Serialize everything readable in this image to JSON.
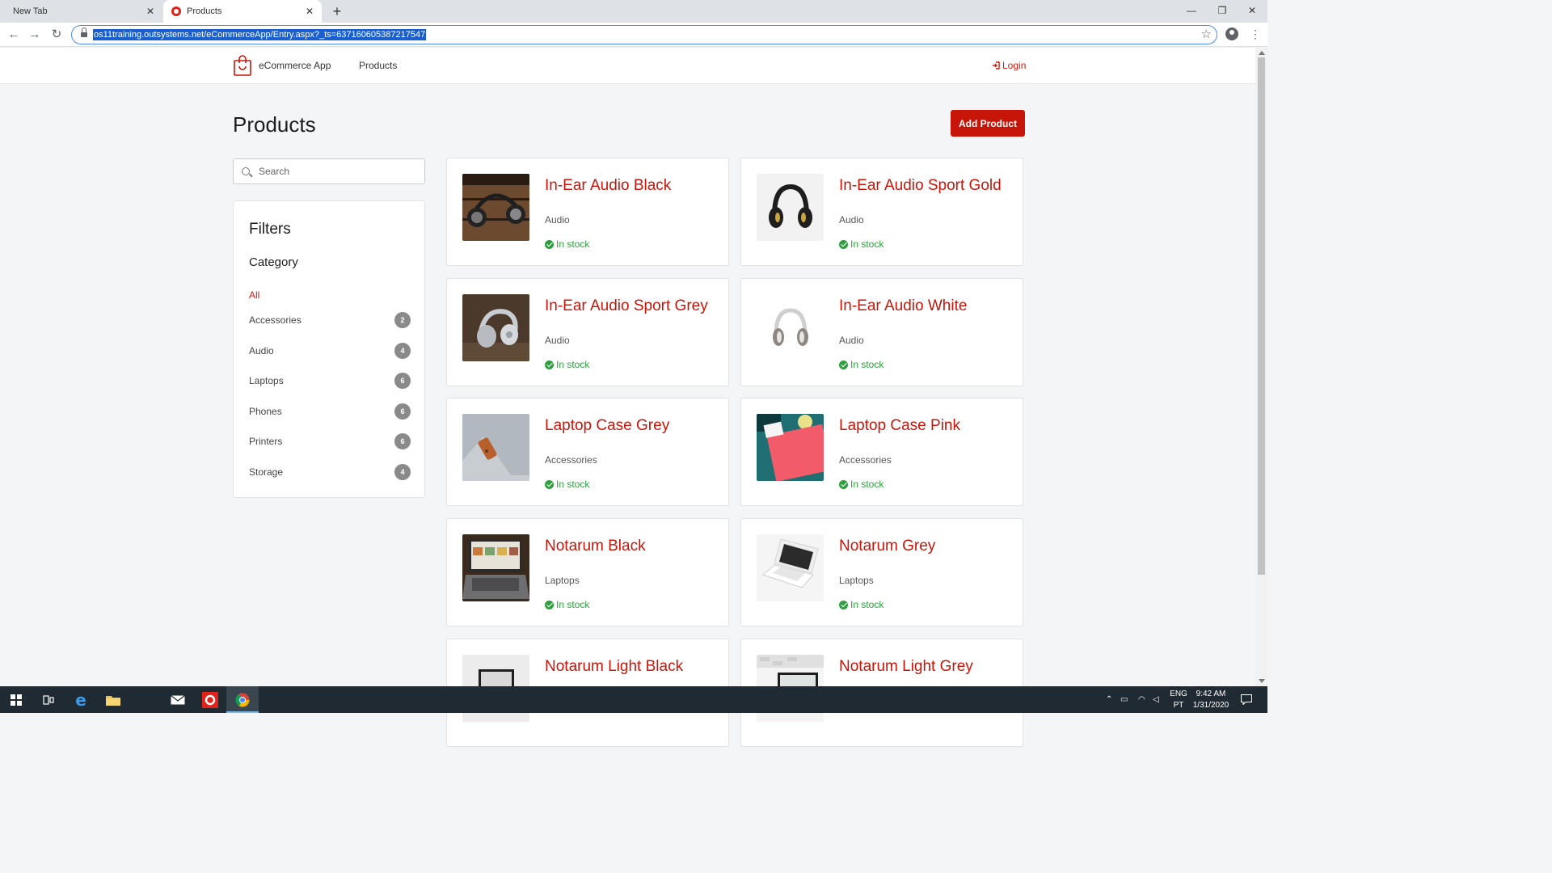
{
  "browser": {
    "tabs": [
      {
        "label": "New Tab",
        "active": false
      },
      {
        "label": "Products",
        "active": true
      }
    ],
    "url": "os11training.outsystems.net/eCommerceApp/Entry.aspx?_ts=637160605387217547"
  },
  "header": {
    "brand": "eCommerce App",
    "nav_products": "Products",
    "login": "Login"
  },
  "page": {
    "title": "Products",
    "add_button": "Add Product",
    "search_placeholder": "Search"
  },
  "filters": {
    "title": "Filters",
    "category_heading": "Category",
    "all_label": "All",
    "categories": [
      {
        "label": "Accessories",
        "count": "2"
      },
      {
        "label": "Audio",
        "count": "4"
      },
      {
        "label": "Laptops",
        "count": "6"
      },
      {
        "label": "Phones",
        "count": "6"
      },
      {
        "label": "Printers",
        "count": "6"
      },
      {
        "label": "Storage",
        "count": "4"
      }
    ]
  },
  "products": [
    {
      "name": "In-Ear Audio Black",
      "category": "Audio",
      "stock": "In stock",
      "thumb": "headphones-on-wood"
    },
    {
      "name": "In-Ear Audio Sport Gold",
      "category": "Audio",
      "stock": "In stock",
      "thumb": "headphones-black-gold"
    },
    {
      "name": "In-Ear Audio Sport Grey",
      "category": "Audio",
      "stock": "In stock",
      "thumb": "headphones-grey-on-wood"
    },
    {
      "name": "In-Ear Audio White",
      "category": "Audio",
      "stock": "In stock",
      "thumb": "headphones-white"
    },
    {
      "name": "Laptop Case Grey",
      "category": "Accessories",
      "stock": "In stock",
      "thumb": "felt-case-grey"
    },
    {
      "name": "Laptop Case Pink",
      "category": "Accessories",
      "stock": "In stock",
      "thumb": "case-pink-teal"
    },
    {
      "name": "Notarum Black",
      "category": "Laptops",
      "stock": "In stock",
      "thumb": "laptop-dark"
    },
    {
      "name": "Notarum Grey",
      "category": "Laptops",
      "stock": "In stock",
      "thumb": "laptop-white"
    },
    {
      "name": "Notarum Light Black",
      "category": "",
      "stock": "",
      "thumb": "laptop-light-black"
    },
    {
      "name": "Notarum Light Grey",
      "category": "",
      "stock": "",
      "thumb": "laptop-light-grey"
    }
  ],
  "taskbar": {
    "language_line1": "ENG",
    "language_line2": "PT",
    "time": "9:42 AM",
    "date": "1/31/2020"
  },
  "colors": {
    "accent": "#c8150a",
    "in_stock": "#2e9e3e",
    "badge": "#8a8a8a"
  }
}
